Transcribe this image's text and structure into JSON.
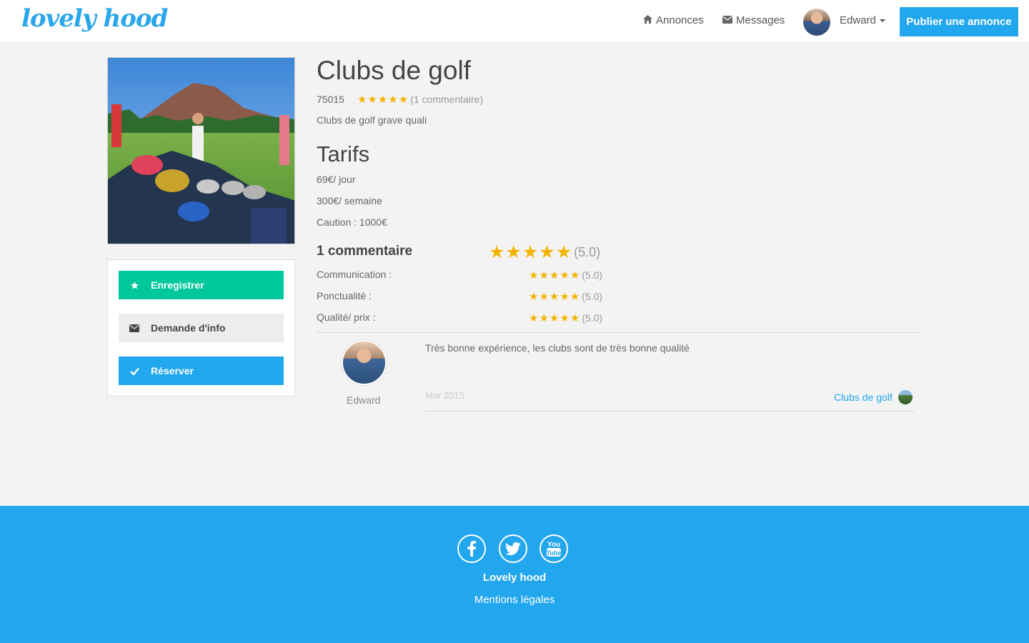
{
  "navbar": {
    "logo": "lovely hood",
    "annonces_label": "Annonces",
    "messages_label": "Messages",
    "user_name": "Edward",
    "publish_label": "Publier une annonce"
  },
  "listing": {
    "title": "Clubs de golf",
    "postcode": "75015",
    "rating": 5,
    "comment_count_label": "(1 commentaire)",
    "description": "Clubs de golf grave quali",
    "photo_icon": "golf-photo"
  },
  "actions": {
    "save_label": "Enregistrer",
    "info_label": "Demande d'info",
    "book_label": "Réserver"
  },
  "tarifs": {
    "title": "Tarifs",
    "day": "69€/ jour",
    "week": "300€/ semaine",
    "deposit": "Caution : 1000€"
  },
  "reviews": {
    "title": "1 commentaire",
    "overall_score": "(5.0)",
    "criteria": [
      {
        "label": "Communication :",
        "score": "(5.0)",
        "stars": 5
      },
      {
        "label": "Ponctualité :",
        "score": "(5.0)",
        "stars": 5
      },
      {
        "label": "Qualité/ prix :",
        "score": "(5.0)",
        "stars": 5
      }
    ],
    "items": [
      {
        "author": "Edward",
        "text": "Très bonne expérience, les clubs sont de très bonne qualité",
        "date": "Mar 2015",
        "item_label": "Clubs de golf"
      }
    ]
  },
  "footer": {
    "brand": "Lovely hood",
    "legal": "Mentions légales",
    "social_icons": [
      "facebook-icon",
      "twitter-icon",
      "youtube-icon"
    ]
  },
  "colors": {
    "brand_blue": "#21a7ee",
    "save_green": "#00c89a",
    "star": "#f3b400"
  }
}
